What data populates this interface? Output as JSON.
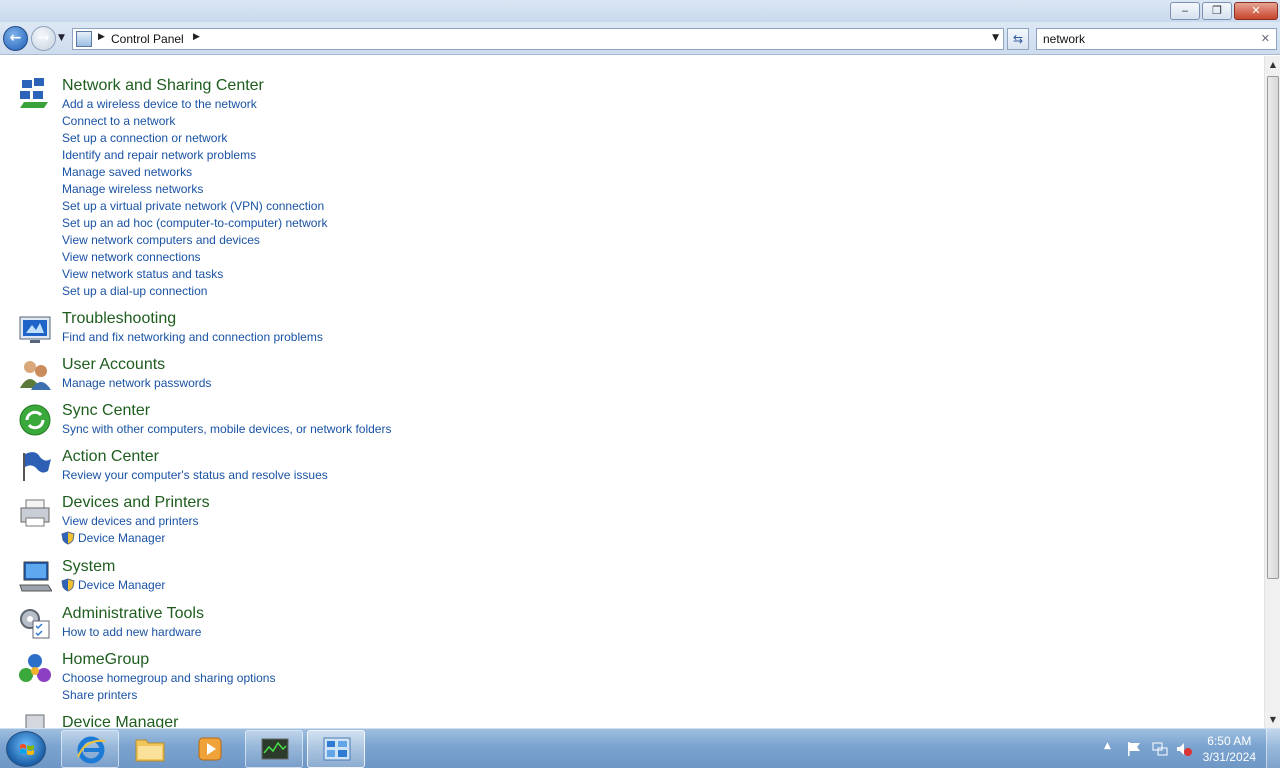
{
  "window": {
    "minimize_glyph": "‒",
    "maximize_glyph": "❐",
    "close_glyph": "✕"
  },
  "nav": {
    "back_glyph": "←",
    "forward_glyph": "→",
    "history_glyph": "▼",
    "separator_glyph": "▶",
    "breadcrumb": "Control Panel",
    "dropdown_glyph": "▼",
    "refresh_glyph": "⇆",
    "search_value": "network",
    "search_clear_glyph": "✕"
  },
  "groups": [
    {
      "title": "Network and Sharing Center",
      "icon": "network-sharing-icon",
      "links": [
        {
          "label": "Add a wireless device to the network"
        },
        {
          "label": "Connect to a network"
        },
        {
          "label": "Set up a connection or network"
        },
        {
          "label": "Identify and repair network problems"
        },
        {
          "label": "Manage saved networks"
        },
        {
          "label": "Manage wireless networks"
        },
        {
          "label": "Set up a virtual private network (VPN) connection"
        },
        {
          "label": "Set up an ad hoc (computer-to-computer) network"
        },
        {
          "label": "View network computers and devices"
        },
        {
          "label": "View network connections"
        },
        {
          "label": "View network status and tasks"
        },
        {
          "label": "Set up a dial-up connection"
        }
      ]
    },
    {
      "title": "Troubleshooting",
      "icon": "troubleshooting-icon",
      "links": [
        {
          "label": "Find and fix networking and connection problems"
        }
      ]
    },
    {
      "title": "User Accounts",
      "icon": "user-accounts-icon",
      "links": [
        {
          "label": "Manage network passwords"
        }
      ]
    },
    {
      "title": "Sync Center",
      "icon": "sync-center-icon",
      "links": [
        {
          "label": "Sync with other computers, mobile devices, or network folders"
        }
      ]
    },
    {
      "title": "Action Center",
      "icon": "action-center-flag-icon",
      "links": [
        {
          "label": "Review your computer's status and resolve issues"
        }
      ]
    },
    {
      "title": "Devices and Printers",
      "icon": "devices-printers-icon",
      "links": [
        {
          "label": "View devices and printers"
        },
        {
          "label": "Device Manager",
          "shield": true
        }
      ]
    },
    {
      "title": "System",
      "icon": "system-computer-icon",
      "links": [
        {
          "label": "Device Manager",
          "shield": true
        }
      ]
    },
    {
      "title": "Administrative Tools",
      "icon": "administrative-tools-icon",
      "links": [
        {
          "label": "How to add new hardware"
        }
      ]
    },
    {
      "title": "HomeGroup",
      "icon": "homegroup-icon",
      "links": [
        {
          "label": "Choose homegroup and sharing options"
        },
        {
          "label": "Share printers"
        }
      ]
    },
    {
      "title": "Device Manager",
      "icon": "device-manager-icon",
      "links": []
    }
  ],
  "scrollbar": {
    "up_glyph": "▲",
    "down_glyph": "▼",
    "grip_glyph": "≡"
  },
  "taskbar": {
    "items": [
      {
        "name": "internet-explorer"
      },
      {
        "name": "windows-explorer"
      },
      {
        "name": "media-player"
      },
      {
        "name": "task-manager"
      },
      {
        "name": "control-panel",
        "active": true
      }
    ],
    "tray": {
      "chevron": "▲",
      "time": "6:50 AM",
      "date": "3/31/2024"
    }
  },
  "colors": {
    "heading_green": "#1e5d1e",
    "link_blue": "#1a53a4",
    "taskbar_blue": "#7aa3cf"
  }
}
